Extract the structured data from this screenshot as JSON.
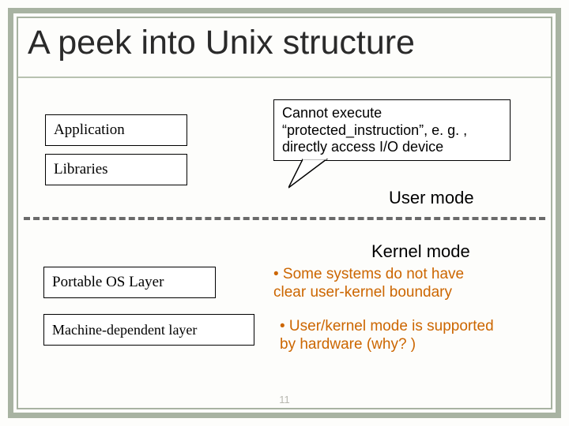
{
  "title": "A peek into Unix structure",
  "boxes": {
    "application": "Application",
    "libraries": "Libraries",
    "portable": "Portable OS Layer",
    "machdep": "Machine-dependent layer"
  },
  "callout_text": "Cannot execute “protected_instruction”, e. g. , directly access I/O device",
  "modes": {
    "user": "User mode",
    "kernel": "Kernel mode"
  },
  "bullets": {
    "b1": "• Some systems do not have clear user-kernel boundary",
    "b2": "• User/kernel mode is supported by hardware (why? )"
  },
  "page_number": "11"
}
